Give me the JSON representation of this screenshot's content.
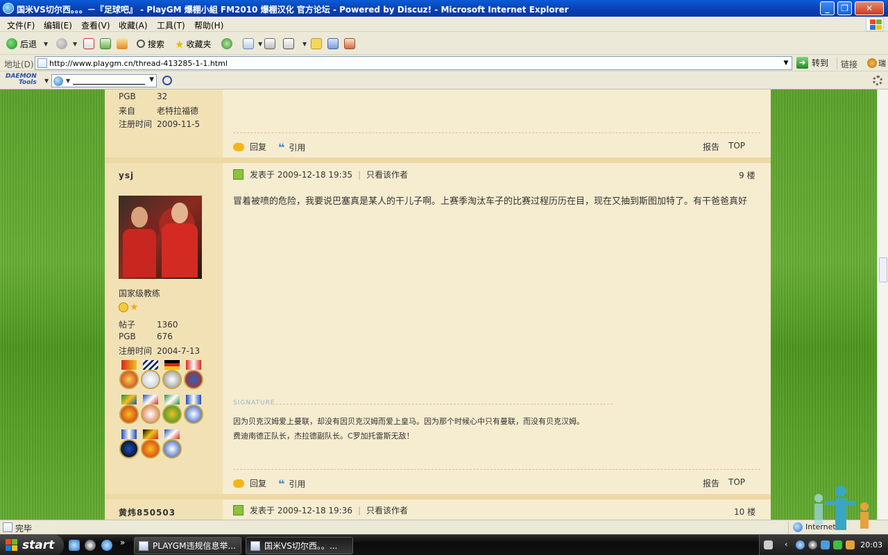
{
  "window": {
    "title": "国米VS切尔西。。。－『足球吧』 - PlayGM 爆棚小組 FM2010 爆棚汉化 官方论坛 - Powered by Discuz! - Microsoft Internet Explorer",
    "minimize": "_",
    "maximize": "❐",
    "close": "✕"
  },
  "menu": [
    "文件(F)",
    "编辑(E)",
    "查看(V)",
    "收藏(A)",
    "工具(T)",
    "帮助(H)"
  ],
  "toolbar": {
    "back_label": "后退",
    "search_label": "搜索",
    "favorites_label": "收藏夹"
  },
  "address": {
    "label": "地址(D)",
    "url": "http://www.playgm.cn/thread-413285-1-1.html",
    "go_label": "转到",
    "links_label": "链接",
    "ext_label": "瑞"
  },
  "daemon": {
    "logo_line1": "DAEMON",
    "logo_line2": "Tools"
  },
  "posts": {
    "prev": {
      "stats": [
        {
          "k": "PGB",
          "v": "32"
        },
        {
          "k": "来自",
          "v": "老特拉福德"
        },
        {
          "k": "注册时间",
          "v": "2009-11-5"
        }
      ],
      "reply_label": "回复",
      "quote_label": "引用",
      "report_label": "报告",
      "top_label": "TOP"
    },
    "current": {
      "username": "ysj",
      "rank": "国家级教练",
      "stats": [
        {
          "k": "帖子",
          "v": "1360"
        },
        {
          "k": "PGB",
          "v": "676"
        },
        {
          "k": "注册时间",
          "v": "2004-7-13"
        }
      ],
      "posted_label": "发表于",
      "posted_time": "2009-12-18 19:35",
      "sep": "|",
      "only_author": "只看该作者",
      "floor": "9 楼",
      "content": "冒着被喷的危险，我要说巴塞真是某人的干儿子啊。上赛季淘汰车子的比赛过程历历在目，现在又抽到斯图加特了。有干爸爸真好",
      "signature_label": "SIGNATURE",
      "signature_line1": "因为贝克汉姆爱上曼联，却没有因贝克汉姆而爱上皇马。因为那个时候心中只有曼联，而没有贝克汉姆。",
      "signature_line2": "费迪南德正队长，杰拉德副队长。C罗加托雷斯无敌！",
      "reply_label": "回复",
      "quote_label": "引用",
      "report_label": "报告",
      "top_label": "TOP"
    },
    "next": {
      "username": "黄炜850503",
      "posted_label": "发表于",
      "posted_time": "2009-12-18 19:36",
      "sep": "|",
      "only_author": "只看该作者",
      "floor": "10 楼"
    }
  },
  "status": {
    "text": "完毕",
    "zone": "Internet"
  },
  "taskbar": {
    "start_label": "start",
    "task1": "PLAYGM违规信息举...",
    "task2": "国米VS切尔西。。...",
    "clock": "20:03",
    "more": "»"
  }
}
